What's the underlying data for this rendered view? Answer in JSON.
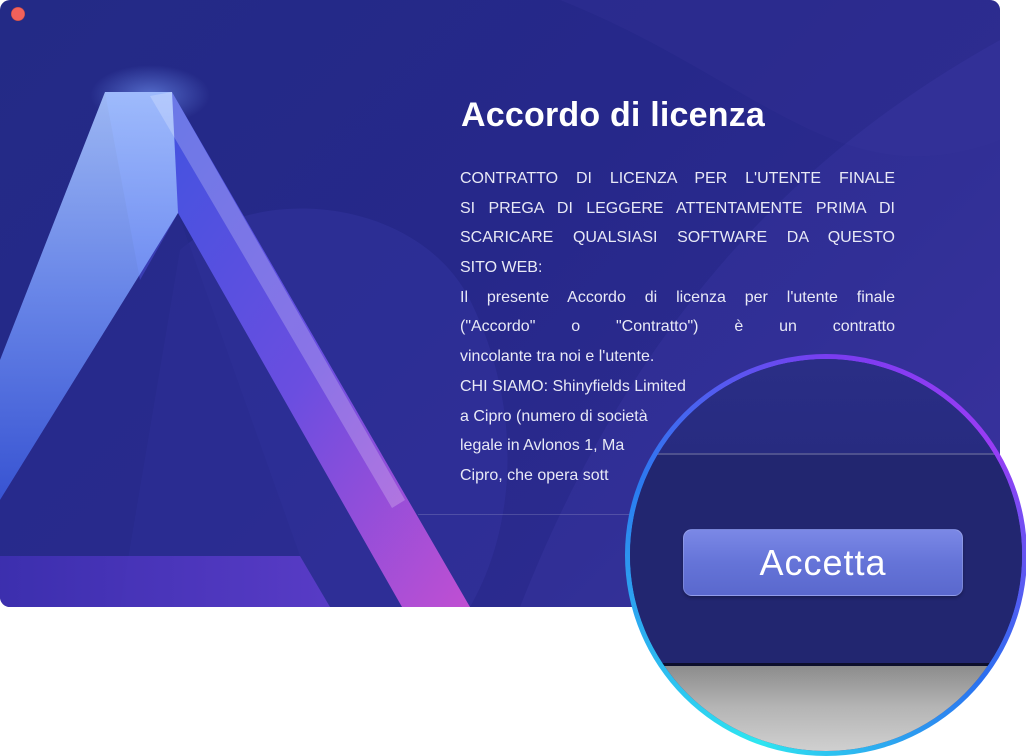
{
  "window": {
    "close_button_color": "#f2615b",
    "background_color": "#26288a"
  },
  "dialog": {
    "title": "Accordo di licenza",
    "license_lines": [
      "CONTRATTO DI LICENZA PER L'UTENTE FINALE",
      "SI PREGA DI LEGGERE ATTENTAMENTE PRIMA DI",
      "SCARICARE QUALSIASI SOFTWARE DA QUESTO",
      "SITO WEB:",
      "Il presente Accordo di licenza per l'utente finale",
      "(\"Accordo\" o \"Contratto\") è un contratto",
      "vincolante tra noi e l'utente.",
      "CHI SIAMO: Shinyfields Limited",
      "a Cipro (numero di società",
      "legale in Avlonos 1, Ma",
      "Cipro, che opera sott"
    ]
  },
  "magnifier": {
    "accept_label": "Accetta",
    "ring_colors": [
      "#2ee6f0",
      "#2b7bf0",
      "#9a3cf5"
    ]
  },
  "icons": {
    "logo": "triangle-logo-icon",
    "close": "close-icon"
  }
}
